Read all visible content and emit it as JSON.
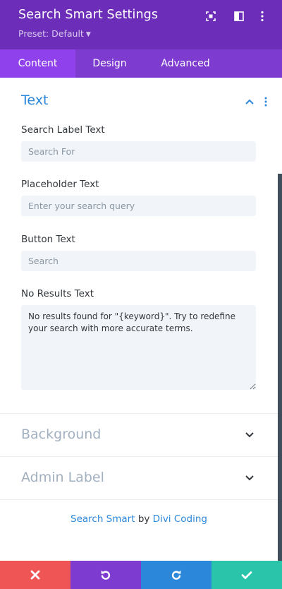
{
  "header": {
    "title": "Search Smart Settings",
    "preset": "Preset: Default",
    "icons": [
      "focus-icon",
      "split-view-icon",
      "more-vertical-icon"
    ]
  },
  "tabs": [
    {
      "label": "Content",
      "active": true
    },
    {
      "label": "Design",
      "active": false
    },
    {
      "label": "Advanced",
      "active": false
    }
  ],
  "sections": {
    "text": {
      "title": "Text",
      "fields": {
        "search_label": {
          "label": "Search Label Text",
          "placeholder": "Search For",
          "value": ""
        },
        "placeholder": {
          "label": "Placeholder Text",
          "placeholder": "Enter your search query",
          "value": ""
        },
        "button": {
          "label": "Button Text",
          "placeholder": "Search",
          "value": ""
        },
        "no_results": {
          "label": "No Results Text",
          "value": "No results found for \"{keyword}\". Try to redefine your search with more accurate terms."
        }
      }
    },
    "background": {
      "title": "Background"
    },
    "admin_label": {
      "title": "Admin Label"
    }
  },
  "footer": {
    "plugin": "Search Smart",
    "by": "by",
    "author": "Divi Coding"
  },
  "bottom_bar": [
    {
      "name": "cancel-button",
      "icon": "close-icon",
      "color": "#ef5555"
    },
    {
      "name": "undo-button",
      "icon": "undo-icon",
      "color": "#7e3bd0"
    },
    {
      "name": "redo-button",
      "icon": "redo-icon",
      "color": "#2b87da"
    },
    {
      "name": "save-button",
      "icon": "check-icon",
      "color": "#29c4a9"
    }
  ],
  "colors": {
    "header_bg": "#6c2eb9",
    "tabs_bg": "#7e3bd0",
    "active_tab_bg": "#8f42ec",
    "accent_blue": "#2b87da"
  }
}
